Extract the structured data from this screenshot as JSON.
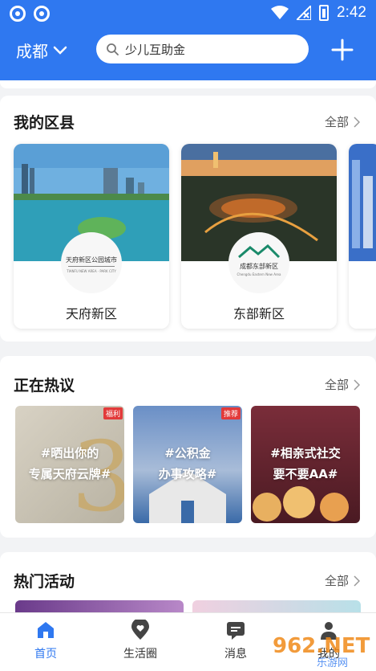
{
  "status_bar": {
    "time": "2:42"
  },
  "header": {
    "city": "成都",
    "search_placeholder": "少儿互助金"
  },
  "districts_section": {
    "title": "我的区县",
    "all_label": "全部",
    "items": [
      {
        "name": "天府新区",
        "logo_text": "天府新区公园城市"
      },
      {
        "name": "东部新区",
        "logo_text": "成都东部新区"
      }
    ]
  },
  "hot_section": {
    "title": "正在热议",
    "all_label": "全部",
    "items": [
      {
        "text_line1": "#晒出你的",
        "text_line2": "专属天府云牌#",
        "tag": "福利"
      },
      {
        "text_line1": "#公积金",
        "text_line2": "办事攻略#",
        "tag": "推荐"
      },
      {
        "text_line1": "#相亲式社交",
        "text_line2": "要不要AA#",
        "tag": ""
      }
    ]
  },
  "activities_section": {
    "title": "热门活动",
    "all_label": "全部"
  },
  "bottom_nav": {
    "items": [
      {
        "label": "首页",
        "active": true
      },
      {
        "label": "生活圈",
        "active": false
      },
      {
        "label": "消息",
        "active": false
      },
      {
        "label": "我的",
        "active": false
      }
    ]
  },
  "watermark": {
    "text": "962.NET",
    "subtext": "乐游网"
  },
  "colors": {
    "primary": "#2f78f0",
    "background": "#f2f3f5",
    "tag_red": "#e23a3a"
  }
}
